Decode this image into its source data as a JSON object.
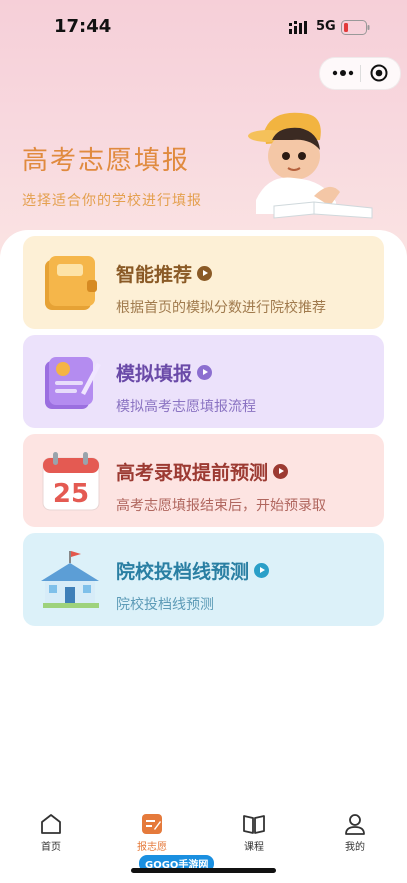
{
  "status_bar": {
    "time": "17:44",
    "network": "5G"
  },
  "hero": {
    "title": "高考志愿填报",
    "subtitle": "选择适合你的学校进行填报"
  },
  "cards": [
    {
      "title": "智能推荐",
      "desc": "根据首页的模拟分数进行院校推荐",
      "bg": "#fdf0d6",
      "title_color": "#8a5a26",
      "desc_color": "#a07a4d",
      "play_color": "#8a5a26"
    },
    {
      "title": "模拟填报",
      "desc": "模拟高考志愿填报流程",
      "bg": "#ece2fb",
      "title_color": "#6a4aa8",
      "desc_color": "#8a73c2",
      "play_color": "#8c6fd0"
    },
    {
      "title": "高考录取提前预测",
      "desc": "高考志愿填报结束后，开始预录取",
      "bg": "#fde4e2",
      "title_color": "#9c3a32",
      "desc_color": "#b0665e",
      "play_color": "#9c3a32"
    },
    {
      "title": "院校投档线预测",
      "desc": "院校投档线预测",
      "bg": "#dcf1f9",
      "title_color": "#2a7fa3",
      "desc_color": "#5d9bb7",
      "play_color": "#2a9fc8"
    }
  ],
  "calendar_number": "25",
  "tabbar": {
    "items": [
      {
        "label": "首页",
        "icon": "home-icon"
      },
      {
        "label": "报志愿",
        "icon": "edit-icon",
        "active": true
      },
      {
        "label": "课程",
        "icon": "book-icon"
      },
      {
        "label": "我的",
        "icon": "user-icon"
      }
    ],
    "active_color": "#e57a3b"
  },
  "watermark": "GOGO手游网"
}
